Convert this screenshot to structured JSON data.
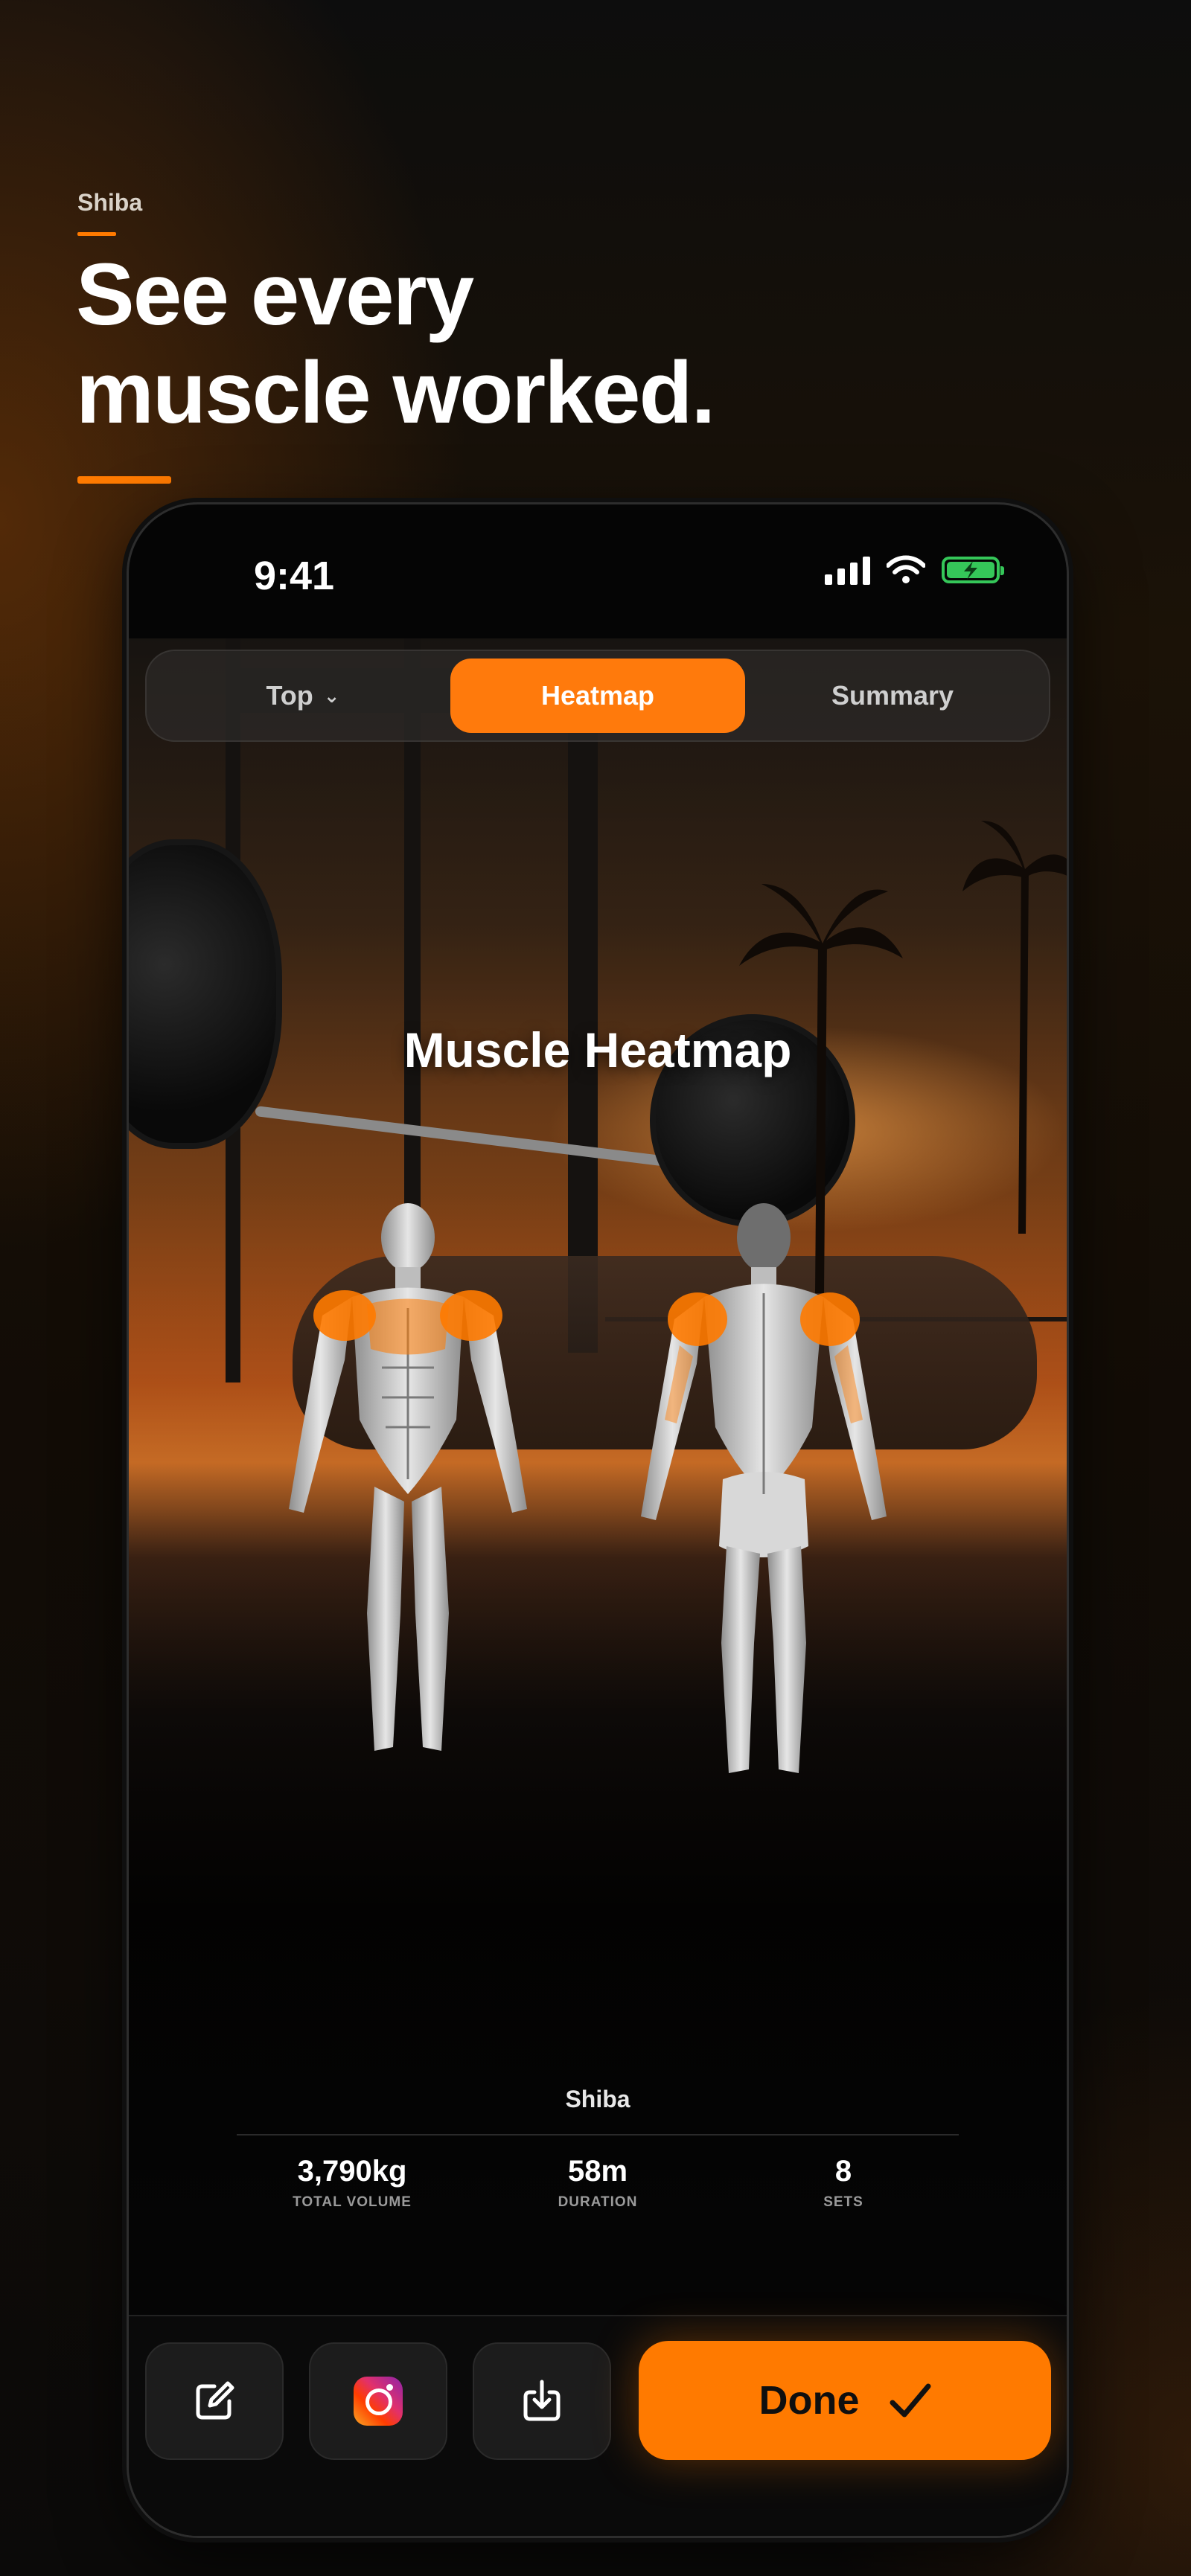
{
  "brand": "Shiba",
  "headline": {
    "line1": "See every",
    "line2": "muscle worked."
  },
  "status_bar": {
    "time": "9:41",
    "icons": [
      "signal-icon",
      "wifi-icon",
      "battery-charging-icon"
    ]
  },
  "tabs": [
    {
      "label": "Top",
      "icon": "chevron-down-icon"
    },
    {
      "label": "Heatmap",
      "selected": true
    },
    {
      "label": "Summary"
    }
  ],
  "heatmap": {
    "title": "Muscle Heatmap",
    "highlighted_muscles": [
      "shoulders",
      "chest",
      "triceps"
    ],
    "highlight_color": "#ff7a00"
  },
  "stats": {
    "name": "Shiba",
    "items": [
      {
        "value": "3,790kg",
        "label": "TOTAL VOLUME"
      },
      {
        "value": "58m",
        "label": "DURATION"
      },
      {
        "value": "8",
        "label": "SETS"
      }
    ]
  },
  "actions": {
    "icons": [
      "edit-icon",
      "instagram-icon",
      "download-icon"
    ],
    "done_label": "Done",
    "done_icon": "checkmark-icon",
    "accent": "#ff7a00"
  }
}
